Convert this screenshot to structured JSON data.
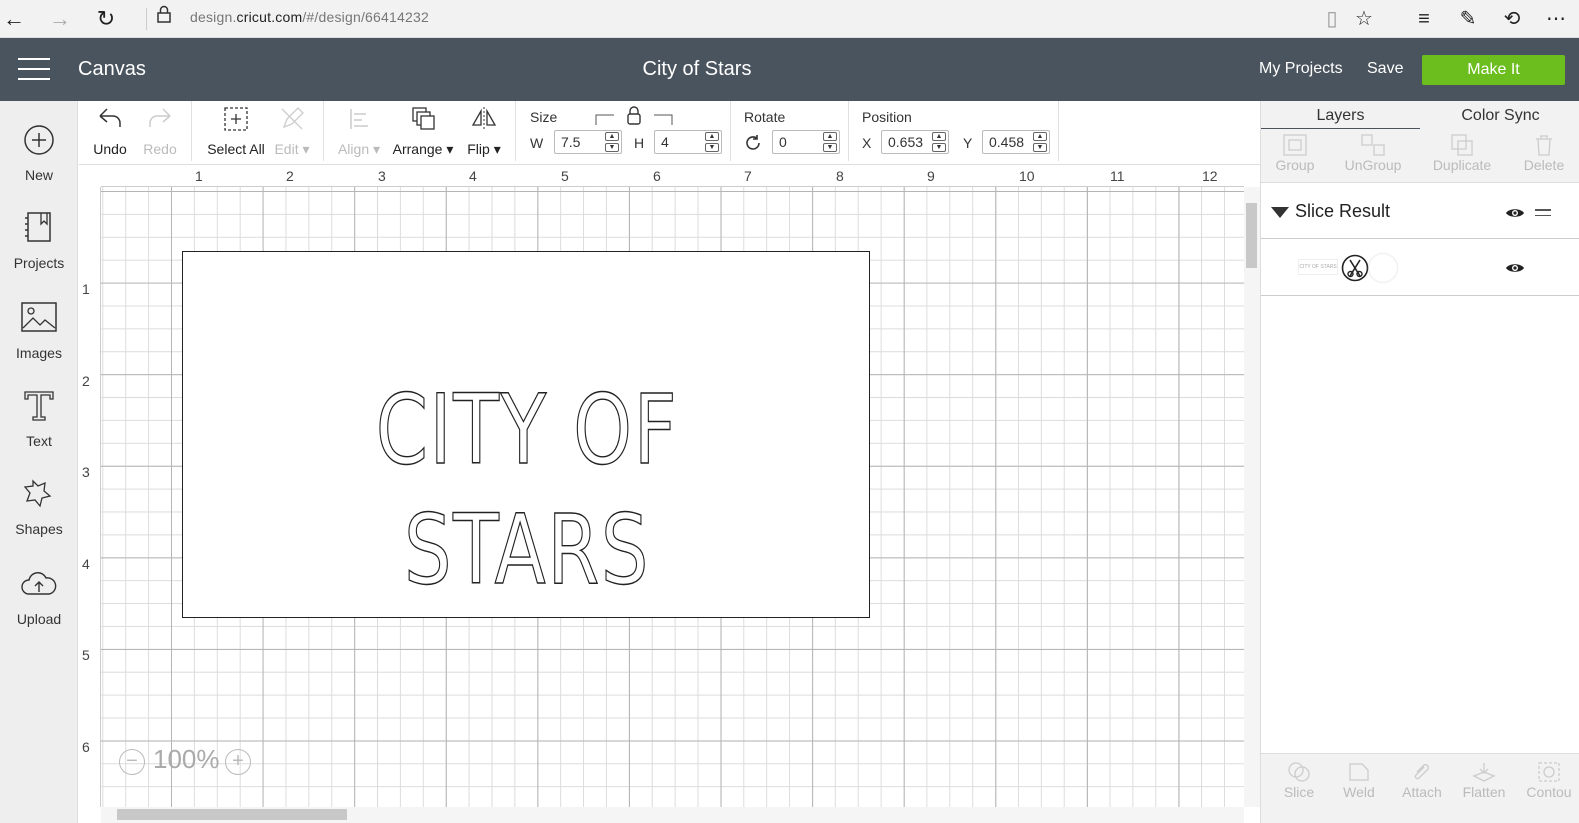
{
  "browser": {
    "url_prefix": "design.",
    "url_domain": "cricut.com",
    "url_path": "/#/design/66414232"
  },
  "header": {
    "app_title": "Canvas",
    "project_name": "City of Stars",
    "my_projects": "My Projects",
    "save": "Save",
    "make_it": "Make It"
  },
  "sidebar": {
    "items": [
      {
        "label": "New",
        "icon": "plus-circle-icon"
      },
      {
        "label": "Projects",
        "icon": "notebook-icon"
      },
      {
        "label": "Images",
        "icon": "image-icon"
      },
      {
        "label": "Text",
        "icon": "text-t-icon"
      },
      {
        "label": "Shapes",
        "icon": "shapes-icon"
      },
      {
        "label": "Upload",
        "icon": "cloud-upload-icon"
      }
    ]
  },
  "toolbar": {
    "undo": "Undo",
    "redo": "Redo",
    "select_all": "Select All",
    "edit": "Edit",
    "align": "Align",
    "arrange": "Arrange",
    "flip": "Flip",
    "size_label": "Size",
    "w_label": "W",
    "w_value": "7.5",
    "h_label": "H",
    "h_value": "4",
    "rotate_label": "Rotate",
    "rotate_value": "0",
    "position_label": "Position",
    "x_label": "X",
    "x_value": "0.653",
    "y_label": "Y",
    "y_value": "0.458"
  },
  "canvas": {
    "ruler_top": [
      "1",
      "2",
      "3",
      "4",
      "5",
      "6",
      "7",
      "8",
      "9",
      "10",
      "11",
      "12"
    ],
    "ruler_left": [
      "1",
      "2",
      "3",
      "4",
      "5",
      "6"
    ],
    "design_text": "CITY OF STARS",
    "zoom": "100%"
  },
  "right_panel": {
    "tabs": [
      "Layers",
      "Color Sync"
    ],
    "tools": [
      "Group",
      "UnGroup",
      "Duplicate",
      "Delete"
    ],
    "layer_group_name": "Slice Result",
    "layer_thumb_text": "CITY OF STARS",
    "bottom_tools": [
      "Slice",
      "Weld",
      "Attach",
      "Flatten",
      "Contou"
    ]
  },
  "colors": {
    "header_bg": "#4a545e",
    "make_it_green": "#6bbe1d"
  }
}
